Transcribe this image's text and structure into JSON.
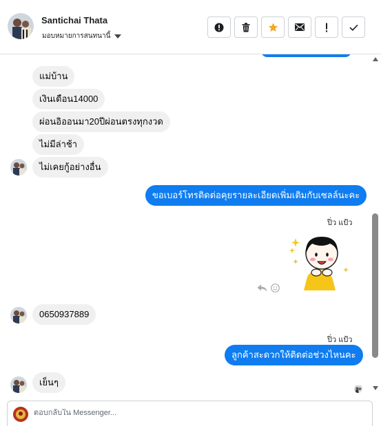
{
  "header": {
    "contact_name": "Santichai Thata",
    "assign_label": "มอบหมายการสนทนานี้",
    "toolbar": [
      {
        "name": "report-icon",
        "title": "report"
      },
      {
        "name": "trash-icon",
        "title": "delete"
      },
      {
        "name": "star-icon",
        "title": "star"
      },
      {
        "name": "mail-icon",
        "title": "mark unread"
      },
      {
        "name": "exclamation-icon",
        "title": "spam"
      },
      {
        "name": "check-icon",
        "title": "done"
      }
    ]
  },
  "messages": [
    {
      "dir": "in",
      "text": "แม่บ้าน"
    },
    {
      "dir": "in",
      "text": "เงินเดือน14000"
    },
    {
      "dir": "in",
      "text": "ผ่อนอิออนมา20ปีผ่อนตรงทุกงวด"
    },
    {
      "dir": "in",
      "text": "ไม่มีล่าช้า"
    },
    {
      "dir": "in",
      "text": "ไม่เคยกู้อย่างอื่น"
    },
    {
      "dir": "out",
      "text": "ขอเบอร์โทรติดต่อคุยรายละเอียดเพิ่มเติมกับเซลล์นะคะ"
    },
    {
      "dir": "out_sticker",
      "sender": "ปิ่ว แป้ว"
    },
    {
      "dir": "in",
      "text": "0650937889"
    },
    {
      "dir": "out",
      "sender": "ปิ่ว แป้ว",
      "text": "ลูกค้าสะดวกให้ติดต่อช่วงไหนคะ"
    },
    {
      "dir": "in",
      "text": "เย็นๆ"
    }
  ],
  "footer": {
    "placeholder": "ตอบกลับใน Messenger..."
  },
  "colors": {
    "outgoing_bubble": "#0f7cf0",
    "incoming_bubble": "#f0f0f0",
    "star": "#f5a623"
  }
}
